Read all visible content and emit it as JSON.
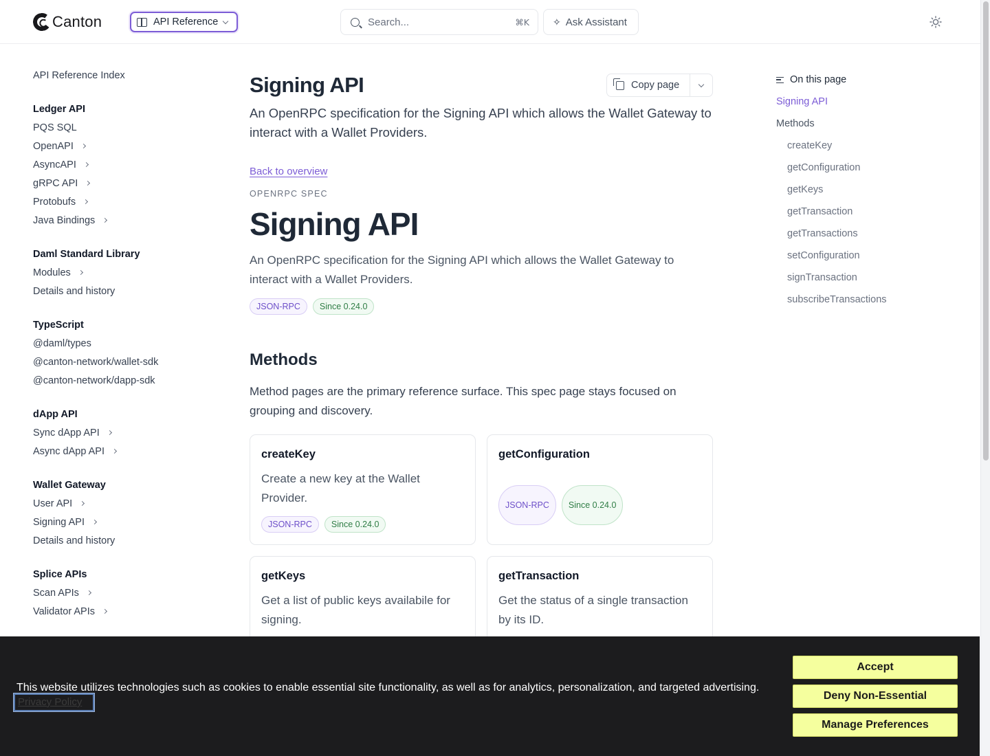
{
  "header": {
    "logo_text": "Canton",
    "section_select": "API Reference",
    "search_placeholder": "Search...",
    "search_shortcut": "⌘K",
    "assistant_label": "Ask Assistant"
  },
  "sidebar": {
    "index_link": "API Reference Index",
    "groups": [
      {
        "heading": "Ledger API",
        "items": [
          "PQS SQL",
          "OpenAPI",
          "AsyncAPI",
          "gRPC API",
          "Protobufs",
          "Java Bindings"
        ]
      },
      {
        "heading": "Daml Standard Library",
        "items": [
          "Modules",
          "Details and history"
        ]
      },
      {
        "heading": "TypeScript",
        "items": [
          "@daml/types",
          "@canton-network/wallet-sdk",
          "@canton-network/dapp-sdk"
        ]
      },
      {
        "heading": "dApp API",
        "items": [
          "Sync dApp API",
          "Async dApp API"
        ]
      },
      {
        "heading": "Wallet Gateway",
        "items": [
          "User API",
          "Signing API",
          "Details and history"
        ]
      },
      {
        "heading": "Splice APIs",
        "items": [
          "Scan APIs",
          "Validator APIs"
        ]
      }
    ]
  },
  "main": {
    "title": "Signing API",
    "copy_label": "Copy page",
    "lead": "An OpenRPC specification for the Signing API which allows the Wallet Gateway to interact with a Wallet Providers.",
    "back_link": "Back to overview",
    "eyebrow": "OPENRPC SPEC",
    "big_title": "Signing API",
    "description": "An OpenRPC specification for the Signing API which allows the Wallet Gateway to interact with a Wallet Providers.",
    "badge_rpc": "JSON-RPC",
    "badge_since": "Since 0.24.0",
    "methods_heading": "Methods",
    "methods_intro": "Method pages are the primary reference surface. This spec page stays focused on grouping and discovery.",
    "cards": [
      {
        "title": "createKey",
        "desc": "Create a new key at the Wallet Provider.",
        "badge_rpc": "JSON-RPC",
        "badge_since": "Since 0.24.0"
      },
      {
        "title": "getConfiguration",
        "desc": "",
        "badge_rpc": "JSON-RPC",
        "badge_since": "Since 0.24.0"
      },
      {
        "title": "getKeys",
        "desc": "Get a list of public keys availabile for signing."
      },
      {
        "title": "getTransaction",
        "desc": "Get the status of a single transaction by its ID."
      }
    ]
  },
  "toc": {
    "heading": "On this page",
    "items": [
      {
        "label": "Signing API",
        "active": true
      },
      {
        "label": "Methods"
      },
      {
        "label": "createKey"
      },
      {
        "label": "getConfiguration"
      },
      {
        "label": "getKeys"
      },
      {
        "label": "getTransaction"
      },
      {
        "label": "getTransactions"
      },
      {
        "label": "setConfiguration"
      },
      {
        "label": "signTransaction"
      },
      {
        "label": "subscribeTransactions"
      }
    ]
  },
  "cookie": {
    "message": "This website utilizes technologies such as cookies to enable essential site functionality, as well as for analytics, personalization, and targeted advertising.",
    "privacy_link": "Privacy Policy",
    "accept": "Accept",
    "deny": "Deny Non-Essential",
    "manage": "Manage Preferences"
  },
  "colors": {
    "accent": "#7c5cd6",
    "cookie_bg": "#1c1c1e",
    "cookie_button": "#f5ff9e"
  }
}
